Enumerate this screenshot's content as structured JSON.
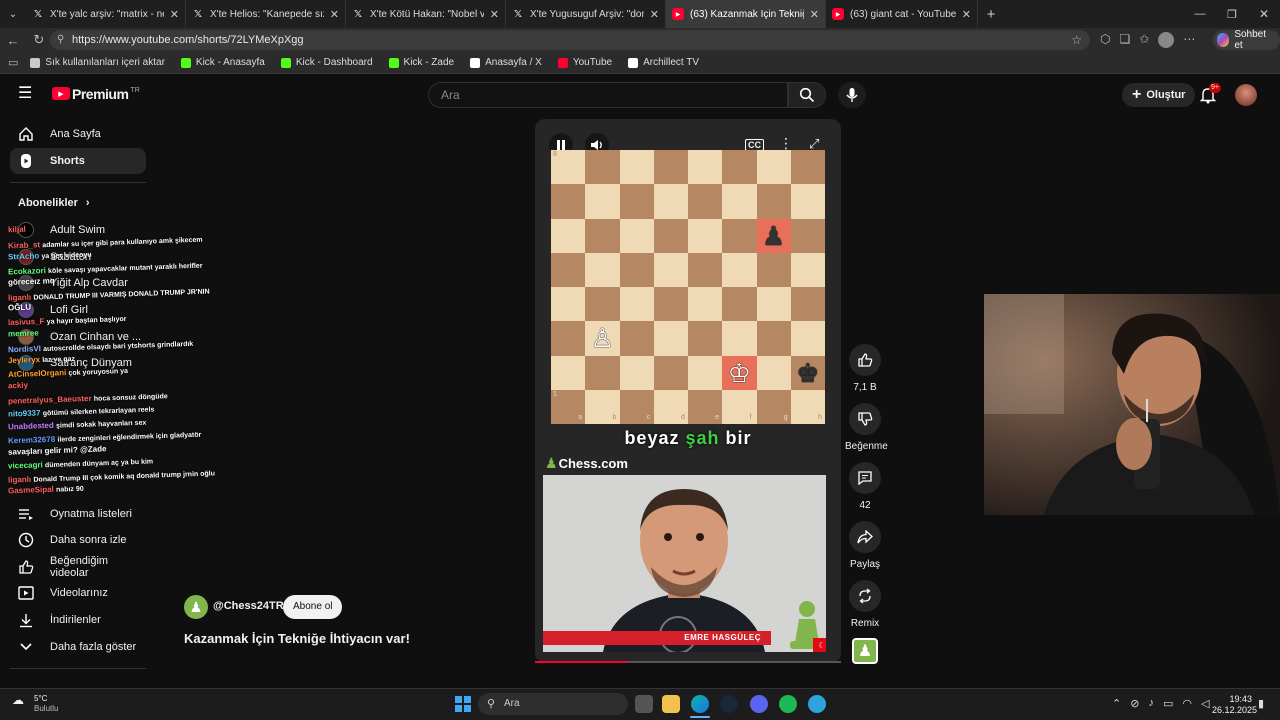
{
  "browser": {
    "tabs": [
      {
        "title": "X'te yalc arşiv: \"matrix - neden bay",
        "icon": "x-logo-icon"
      },
      {
        "title": "X'te Helios: \"Kanepede sızıp kalınca",
        "icon": "x-logo-icon"
      },
      {
        "title": "X'te Kötü Hakan: \"Nobel verilmeli",
        "icon": "x-logo-icon"
      },
      {
        "title": "X'te Yugusuguf Arşiv: \"donald trum",
        "icon": "x-logo-icon"
      },
      {
        "title": "(63) Kazanmak İçin Tekniğe İh",
        "icon": "youtube-icon",
        "active": true
      },
      {
        "title": "(63) giant cat - YouTube",
        "icon": "youtube-icon"
      }
    ],
    "url": "https://www.youtube.com/shorts/72LYMeXpXgg",
    "sohbet_label": "Sohbet et",
    "bookmarks": [
      {
        "label": "Sık kullanılanları içeri aktar",
        "color": "#c9c9c9"
      },
      {
        "label": "Kick - Anasayfa",
        "color": "#53fc18"
      },
      {
        "label": "Kick - Dashboard",
        "color": "#53fc18"
      },
      {
        "label": "Kick - Zade",
        "color": "#53fc18"
      },
      {
        "label": "Anasayfa / X",
        "color": "#ffffff"
      },
      {
        "label": "YouTube",
        "color": "#ff0033"
      },
      {
        "label": "Archillect TV",
        "color": "#ffffff"
      }
    ]
  },
  "youtube": {
    "logo_text": "Premium",
    "logo_region": "TR",
    "search_placeholder": "Ara",
    "create_label": "Oluştur",
    "notification_count": "9+",
    "sidebar": {
      "home": "Ana Sayfa",
      "shorts": "Shorts",
      "subscriptions_header": "Abonelikler",
      "subs": [
        "Adult Swim",
        "Sabaton",
        "Yiğit Alp Cavdar",
        "Lofi Girl",
        "Ozan Cinhan ve ...",
        "Satranç Dünyam"
      ],
      "playlists": "Oynatma listeleri",
      "watch_later": "Daha sonra izle",
      "liked": "Beğendiğim videolar",
      "your_videos": "Videolarınız",
      "downloads": "İndirilenler",
      "show_more": "Daha fazla göster"
    },
    "short": {
      "caption_words": [
        "beyaz",
        "şah",
        "bir"
      ],
      "brand": "Chess.com",
      "presenter": "EMRE HASGÜLEÇ",
      "channel": "@Chess24TR",
      "subscribe": "Abone ol",
      "title": "Kazanmak İçin Tekniğe İhtiyacın var!",
      "like_count": "7,1 B",
      "dislike_label": "Beğenme",
      "comment_count": "42",
      "share_label": "Paylaş",
      "remix_label": "Remix",
      "files": [
        "a",
        "b",
        "c",
        "d",
        "e",
        "f",
        "g",
        "h"
      ],
      "rank_1": "1",
      "rank_8": "8",
      "pieces": [
        {
          "glyph": "♟",
          "square": "g6",
          "color": "#333333"
        },
        {
          "glyph": "♙",
          "square": "b3",
          "color": "#ffffff"
        },
        {
          "glyph": "♔",
          "square": "f2",
          "color": "#ffffff"
        },
        {
          "glyph": "♚",
          "square": "h2",
          "color": "#333333"
        }
      ],
      "highlights": [
        "g6",
        "f2"
      ]
    }
  },
  "chat": [
    {
      "user": "kiljal",
      "msg": "",
      "color": "#ff5f5f"
    },
    {
      "user": "Kirab_st",
      "msg": "adamlar su içer gibi para kullanıyo amk şikecem",
      "color": "#ff5f5f"
    },
    {
      "user": "StrAcho",
      "msg": "ya geç videoyu",
      "color": "#5fd3ff"
    },
    {
      "user": "Ecokazori",
      "msg": "köle savaşı yapavcaklar mutant yaraklı herifler",
      "color": "#5fff7f"
    },
    {
      "user": "göreceız mq",
      "msg": "",
      "color": "#ffffff"
    },
    {
      "user": "liganlı",
      "msg": "DONALD TRUMP III VARMIŞ DONALD TRUMP JR'NIN",
      "color": "#ff5f5f"
    },
    {
      "user": "OĞLU",
      "msg": "",
      "color": "#ffffff"
    },
    {
      "user": "lasivus_F",
      "msg": "ya hayır baştan başlıyor",
      "color": "#ff5f5f"
    },
    {
      "user": "memree",
      "msg": "",
      "color": "#5fff7f"
    },
    {
      "user": "NordisVI",
      "msg": "autoscrollde olsaydı bari ytshorts grindlardık",
      "color": "#8fb0ff"
    },
    {
      "user": "Jeyleryx",
      "msg": "laz ve gaz",
      "color": "#ff9f2f"
    },
    {
      "user": "AtCinselOrgani",
      "msg": "çok yoruyosun ya",
      "color": "#ff9f2f"
    },
    {
      "user": "ackiy",
      "msg": "",
      "color": "#ff5f5f"
    },
    {
      "user": "penetralyus_Baeuster",
      "msg": "hoca sonsuz döngüde",
      "color": "#ff5f5f"
    },
    {
      "user": "nito9337",
      "msg": "götümü silerken tekrarlayan reels",
      "color": "#5fd3ff"
    },
    {
      "user": "Unabdested",
      "msg": "şimdi sokak hayvanları sex",
      "color": "#bf7fff"
    },
    {
      "user": "Kerem32678",
      "msg": "ilerde zenginleri eğlendirmek için gladyatör",
      "color": "#5f9fff"
    },
    {
      "user": "savaşları gelir mi? @Zade",
      "msg": "",
      "color": "#ffffff"
    },
    {
      "user": "vicecagri",
      "msg": "dümenden dünyam aç ya bu kim",
      "color": "#5fff7f"
    },
    {
      "user": "liganlı",
      "msg": "Donald Trump III çok komik aq donald trump jrnin oğlu",
      "color": "#ff5f5f"
    },
    {
      "user": "GasmeSipal",
      "msg": "nabız 90",
      "color": "#ff5f5f"
    }
  ],
  "taskbar": {
    "weather_temp": "5°C",
    "weather_desc": "Bulutlu",
    "search_label": "Ara",
    "time": "19:43",
    "date": "26.12.2025"
  },
  "colors": {
    "yt_red": "#ff0033",
    "light_square": "#f0d9b5",
    "dark_square": "#b58863",
    "highlight": "#e8705a",
    "chess_green": "#81b64c"
  }
}
